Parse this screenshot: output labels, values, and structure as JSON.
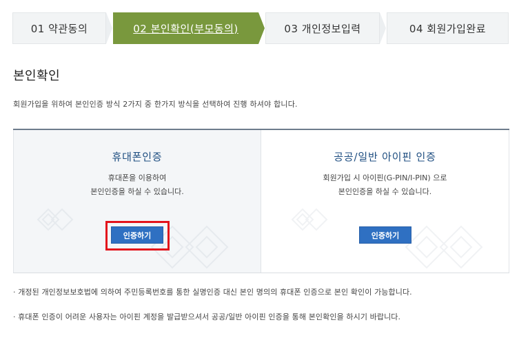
{
  "steps": [
    {
      "label": "01 약관동의"
    },
    {
      "label": "02 본인확인(부모동의)"
    },
    {
      "label": "03 개인정보입력"
    },
    {
      "label": "04 회원가입완료"
    }
  ],
  "title": "본인확인",
  "description": "회원가입을 위하여 본인인증 방식 2가지 중 한가지 방식을 선택하여 진행 하셔야 합니다.",
  "phone_auth": {
    "title": "휴대폰인증",
    "desc_line1": "휴대폰을 이용하여",
    "desc_line2": "본인인증을 하실 수 있습니다.",
    "button": "인증하기"
  },
  "ipin_auth": {
    "title": "공공/일반 아이핀 인증",
    "desc_line1": "회원가입 시 아이핀(G-PIN/I-PIN) 으로",
    "desc_line2": "본인인증을 하실 수 있습니다.",
    "button": "인증하기"
  },
  "notes": [
    "· 개정된 개인정보보호법에 의하여 주민등록번호를 통한 실명인증 대신 본인 명의의 휴대폰 인증으로 본인 확인이 가능합니다.",
    "· 휴대폰 인증이 어려운 사용자는 아이핀 계정을 발급받으셔서 공공/일반 아이핀 인증을 통해 본인확인을 하시기 바랍니다."
  ],
  "colors": {
    "active_step": "#79983d",
    "button": "#2f70c2",
    "highlight": "#e3121b",
    "panel_title": "#1d4d80"
  }
}
